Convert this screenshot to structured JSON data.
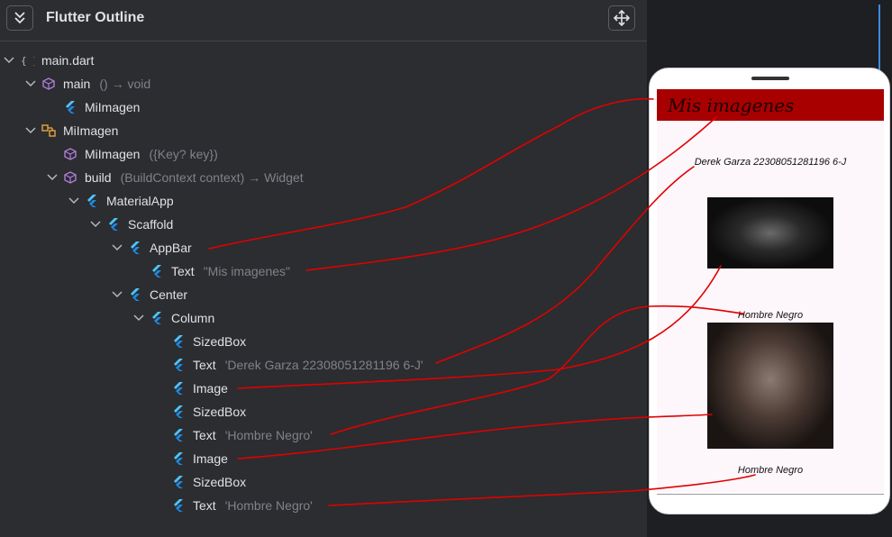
{
  "panel": {
    "title": "Flutter Outline"
  },
  "tree": [
    {
      "name": "main.dart",
      "detail": "",
      "icon": "braces-icon",
      "chev": "down"
    },
    {
      "name": "main",
      "detail": "() → void",
      "icon": "function-cube-icon",
      "chev": "down"
    },
    {
      "name": "MiImagen",
      "detail": "",
      "icon": "flutter-widget-icon",
      "chev": "none"
    },
    {
      "name": "MiImagen",
      "detail": "",
      "icon": "class-icon",
      "chev": "down"
    },
    {
      "name": "MiImagen",
      "detail": "({Key? key})",
      "icon": "constructor-cube-icon",
      "chev": "none"
    },
    {
      "name": "build",
      "detail": "(BuildContext context) → Widget",
      "icon": "method-cube-icon",
      "chev": "down"
    },
    {
      "name": "MaterialApp",
      "detail": "",
      "icon": "flutter-widget-icon",
      "chev": "down"
    },
    {
      "name": "Scaffold",
      "detail": "",
      "icon": "flutter-widget-icon",
      "chev": "down"
    },
    {
      "name": "AppBar",
      "detail": "",
      "icon": "flutter-widget-icon",
      "chev": "down"
    },
    {
      "name": "Text",
      "detail": "\"Mis imagenes\"",
      "icon": "flutter-widget-icon",
      "chev": "none"
    },
    {
      "name": "Center",
      "detail": "",
      "icon": "flutter-widget-icon",
      "chev": "down"
    },
    {
      "name": "Column",
      "detail": "",
      "icon": "flutter-widget-icon",
      "chev": "down"
    },
    {
      "name": "SizedBox",
      "detail": "",
      "icon": "flutter-widget-icon",
      "chev": "none"
    },
    {
      "name": "Text",
      "detail": "'Derek Garza 22308051281196 6-J'",
      "icon": "flutter-widget-icon",
      "chev": "none"
    },
    {
      "name": "Image",
      "detail": "",
      "icon": "flutter-widget-icon",
      "chev": "none"
    },
    {
      "name": "SizedBox",
      "detail": "",
      "icon": "flutter-widget-icon",
      "chev": "none"
    },
    {
      "name": "Text",
      "detail": "'Hombre Negro'",
      "icon": "flutter-widget-icon",
      "chev": "none"
    },
    {
      "name": "Image",
      "detail": "",
      "icon": "flutter-widget-icon",
      "chev": "none"
    },
    {
      "name": "SizedBox",
      "detail": "",
      "icon": "flutter-widget-icon",
      "chev": "none"
    },
    {
      "name": "Text",
      "detail": "'Hombre Negro'",
      "icon": "flutter-widget-icon",
      "chev": "none"
    }
  ],
  "phone": {
    "appbar_title": "Mis imagenes",
    "author": "Derek Garza 22308051281196 6-J",
    "caption1": "Hombre Negro",
    "caption2": "Hombre Negro"
  },
  "colors": {
    "accent_red": "#a80000",
    "annotation_red": "#e00000",
    "flutter_blue": "#4fc3f7",
    "class_orange": "#e8a33d",
    "method_purple": "#b07cd8"
  }
}
